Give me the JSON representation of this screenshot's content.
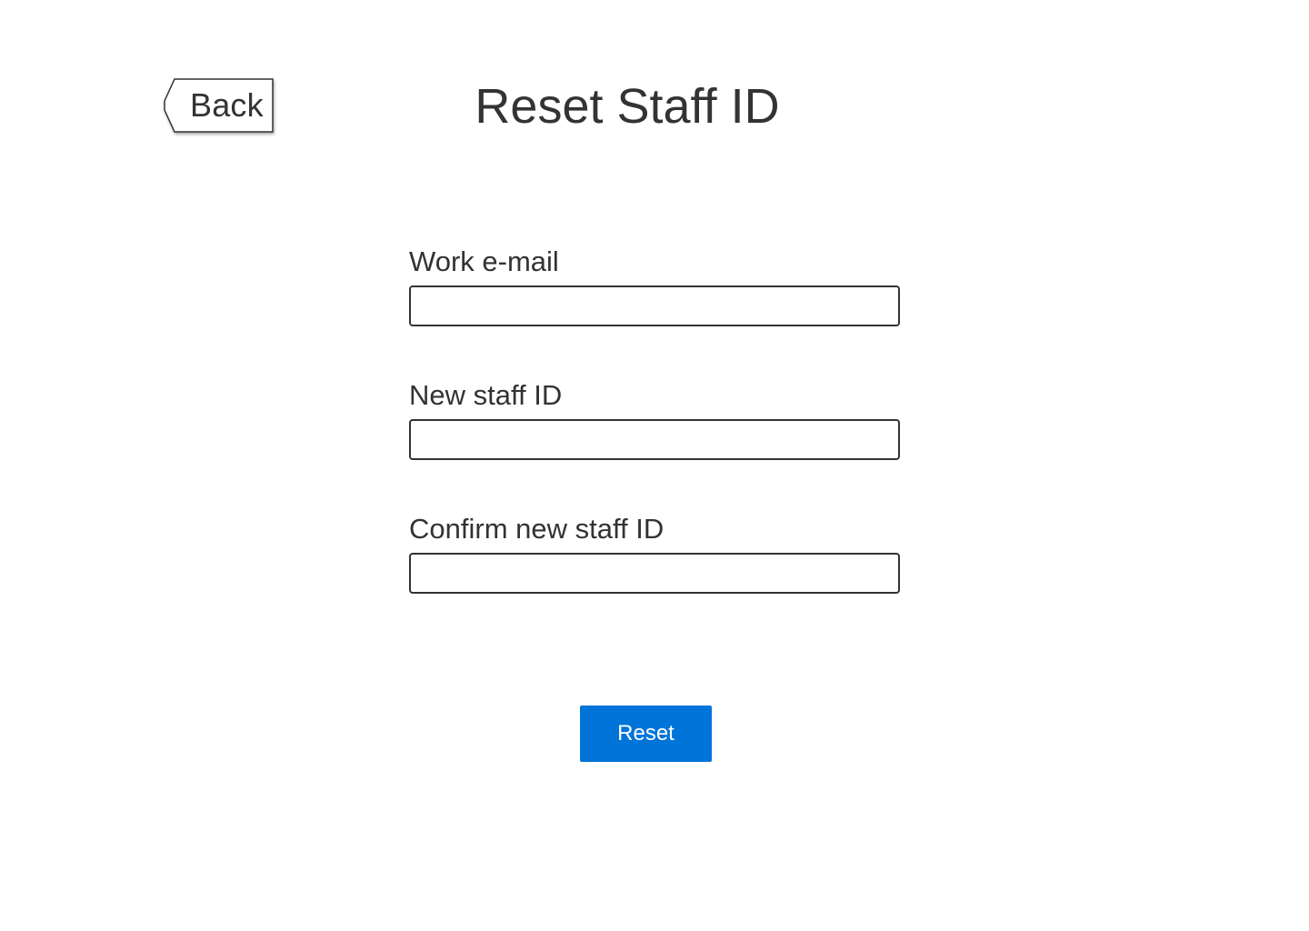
{
  "header": {
    "title": "Reset Staff ID",
    "back_label": "Back"
  },
  "form": {
    "fields": [
      {
        "label": "Work e-mail",
        "value": "",
        "placeholder": ""
      },
      {
        "label": "New staff ID",
        "value": "",
        "placeholder": ""
      },
      {
        "label": "Confirm new staff ID",
        "value": "",
        "placeholder": ""
      }
    ],
    "submit_label": "Reset"
  },
  "colors": {
    "accent": "#0074d9",
    "text": "#333333",
    "background": "#ffffff"
  },
  "icons": {
    "back": "back-arrow-tag-icon"
  }
}
